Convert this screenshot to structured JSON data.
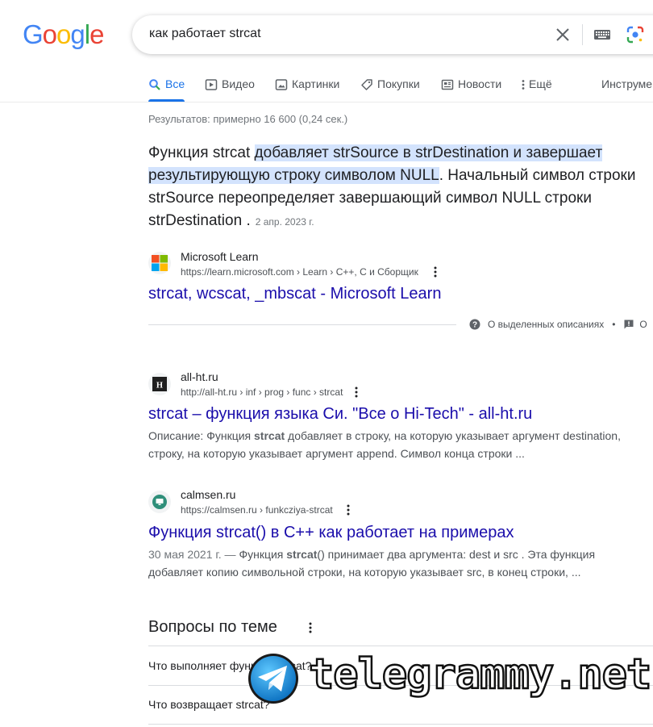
{
  "logo": {
    "letters": [
      "G",
      "o",
      "o",
      "g",
      "l",
      "e"
    ],
    "colors": [
      "#4285F4",
      "#EA4335",
      "#FBBC05",
      "#4285F4",
      "#34A853",
      "#EA4335"
    ]
  },
  "search": {
    "query": "как работает strcat"
  },
  "tabs": [
    {
      "label": "Все",
      "icon": "search-icon",
      "active": true
    },
    {
      "label": "Видео",
      "icon": "video-icon"
    },
    {
      "label": "Картинки",
      "icon": "image-icon"
    },
    {
      "label": "Покупки",
      "icon": "tag-icon"
    },
    {
      "label": "Новости",
      "icon": "news-icon"
    },
    {
      "label": "Ещё",
      "icon": "more-vert-icon"
    },
    {
      "label": "Инструменты"
    }
  ],
  "stats": "Результатов: примерно 16 600 (0,24 сек.)",
  "snippet": {
    "prefix": "Функция strcat ",
    "highlight": "добавляет strSource в strDestination и завершает результирующую строку символом NULL",
    "rest": ". Начальный символ строки strSource переопределяет завершающий символ NULL строки strDestination .",
    "date": "2 апр. 2023 г.",
    "source": {
      "site": "Microsoft Learn",
      "url": "https://learn.microsoft.com › Learn › C++, C и Сборщик",
      "title": "strcat, wcscat, _mbscat - Microsoft Learn"
    },
    "about_label": "О выделенных описаниях",
    "feedback_label": "О"
  },
  "results": [
    {
      "site": "all-ht.ru",
      "url": "http://all-ht.ru › inf › prog › func › strcat",
      "title": "strcat – функция языка Си. \"Все о Hi-Tech\" - all-ht.ru",
      "desc_a": "Описание: Функция ",
      "desc_bold": "strcat",
      "desc_b": " добавляет в строку, на которую указывает аргумент destination, строку, на которую указывает аргумент append. Символ конца строки ..."
    },
    {
      "site": "calmsen.ru",
      "url": "https://calmsen.ru › funkcziya-strcat",
      "title": "Функция strcat() в C++ как работает на примерах",
      "desc_date": "30 мая 2021 г. — ",
      "desc_a": "Функция ",
      "desc_bold": "strcat",
      "desc_b": "() принимает два аргумента: dest и src . Эта функция добавляет копию символьной строки, на которую указывает src, в конец строки, ..."
    }
  ],
  "paa": {
    "title": "Вопросы по теме",
    "questions": [
      "Что выполняет функция strcat?",
      "Что возвращает strcat?"
    ]
  },
  "watermark": {
    "text": "telegrammy.net"
  }
}
